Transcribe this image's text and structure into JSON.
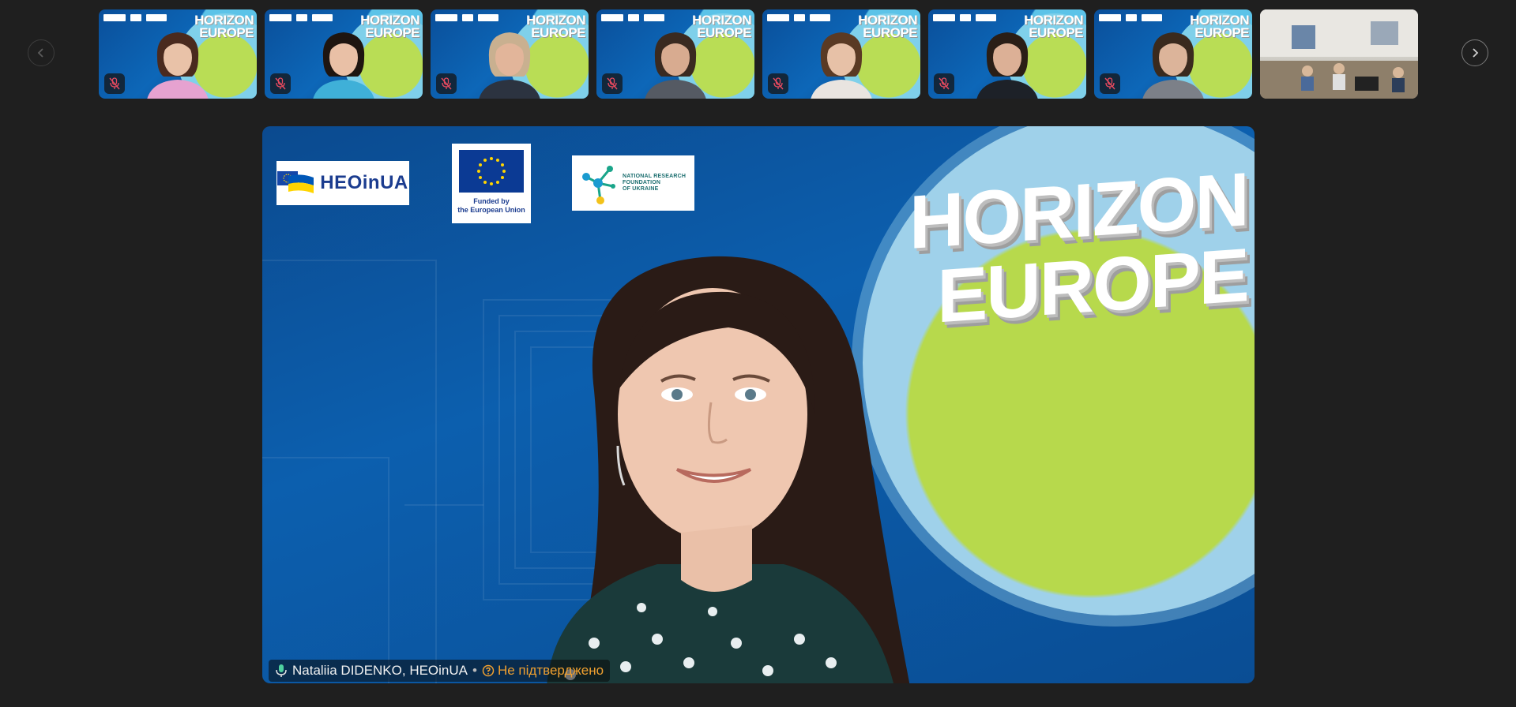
{
  "navigation": {
    "prev_icon": "chevron-left-icon",
    "next_icon": "chevron-right-icon"
  },
  "participants": [
    {
      "id": "p1",
      "muted": true,
      "hair": "#4a2a1e",
      "shirt": "#e6a2d0",
      "skin": "#e9c2a8"
    },
    {
      "id": "p2",
      "muted": true,
      "hair": "#1e1510",
      "shirt": "#3fb0d8",
      "skin": "#e9c0a6"
    },
    {
      "id": "p3",
      "muted": true,
      "hair": "#c9b090",
      "shirt": "#2c3340",
      "skin": "#e2b59a"
    },
    {
      "id": "p4",
      "muted": true,
      "hair": "#3a2a20",
      "shirt": "#555a63",
      "skin": "#d8ab90"
    },
    {
      "id": "p5",
      "muted": true,
      "hair": "#5a3a24",
      "shirt": "#e9e4e0",
      "skin": "#e7c1a7"
    },
    {
      "id": "p6",
      "muted": true,
      "hair": "#2a1e16",
      "shirt": "#1d2128",
      "skin": "#dcb096"
    },
    {
      "id": "p7",
      "muted": true,
      "hair": "#3a2a1e",
      "shirt": "#7c8088",
      "skin": "#dcb49a"
    },
    {
      "id": "p8",
      "muted": true,
      "room": true
    }
  ],
  "main_video": {
    "speaker_name": "Nataliia DIDENKO, HEOinUA",
    "separator": "•",
    "verification_status": "Не підтверджено",
    "mic_icon": "microphone-active-icon",
    "status_icon": "question-circle-icon",
    "logos": {
      "heo_text": "HEOinUA",
      "eu_caption_line1": "Funded by",
      "eu_caption_line2": "the European Union",
      "nrf_line1": "NATIONAL RESEARCH",
      "nrf_line2": "FOUNDATION",
      "nrf_line3": "OF UKRAINE"
    },
    "background_title_line1": "HORIZON",
    "background_title_line2": "EUROPE"
  },
  "colors": {
    "page_bg": "#1f1f1f",
    "status_warning": "#f0a030",
    "mic_active": "#4fd1a0",
    "mic_muted": "#e84a5f"
  }
}
